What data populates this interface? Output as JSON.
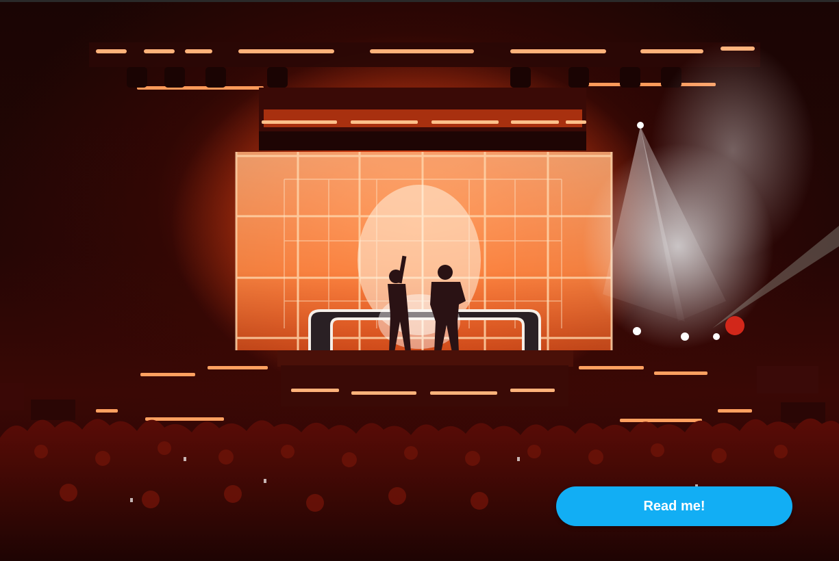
{
  "cta": {
    "label": "Read me!"
  },
  "colors": {
    "button_bg": "#12aef4",
    "button_text": "#ffffff",
    "stage_light": "#ff7a2e",
    "haze": "#e8eef2"
  },
  "photo": {
    "icons": [
      "concert-stage-photo"
    ]
  }
}
